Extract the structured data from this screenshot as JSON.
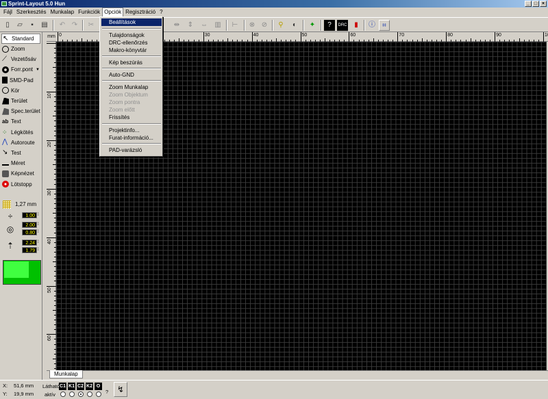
{
  "window": {
    "title": "Sprint-Layout 5.0 Hun"
  },
  "menu": [
    "Fájl",
    "Szerkesztés",
    "Munkalap",
    "Funkciók",
    "Opciók",
    "Regisztráció",
    "?"
  ],
  "dropdown": {
    "items": [
      {
        "label": "Beállítások",
        "state": "highlighted"
      },
      {
        "label": "Tulajdonságok",
        "state": "enabled"
      },
      {
        "label": "DRC-ellenőrzés",
        "state": "enabled"
      },
      {
        "label": "Makro-könyvtár",
        "state": "enabled"
      },
      {
        "label": "Kép beszúrás",
        "state": "enabled"
      },
      {
        "label": "Auto-GND",
        "state": "enabled"
      },
      {
        "label": "Zoom Munkalap",
        "state": "enabled"
      },
      {
        "label": "Zoom Objektum",
        "state": "disabled"
      },
      {
        "label": "Zoom pontra",
        "state": "disabled"
      },
      {
        "label": "Zoom előtt",
        "state": "disabled"
      },
      {
        "label": "Frissítés",
        "state": "enabled"
      },
      {
        "label": "Projektinfo...",
        "state": "enabled"
      },
      {
        "label": "Furat-információ...",
        "state": "enabled"
      },
      {
        "label": "PAD-varázsló",
        "state": "enabled"
      }
    ]
  },
  "tools": [
    {
      "label": "Standard",
      "icon": "arrow-icon"
    },
    {
      "label": "Zoom",
      "icon": "zoom-icon"
    },
    {
      "label": "Vezetősáv",
      "icon": "track-icon"
    },
    {
      "label": "Forr.pont",
      "icon": "solder-pad-icon"
    },
    {
      "label": "SMD-Pad",
      "icon": "smd-pad-icon"
    },
    {
      "label": "Kör",
      "icon": "circle-icon"
    },
    {
      "label": "Terület",
      "icon": "zone-icon"
    },
    {
      "label": "Spec.terület",
      "icon": "special-zone-icon"
    },
    {
      "label": "Text",
      "icon": "text-icon"
    },
    {
      "label": "Légkötés",
      "icon": "airwire-icon"
    },
    {
      "label": "Autoroute",
      "icon": "autoroute-icon"
    },
    {
      "label": "Test",
      "icon": "test-icon"
    },
    {
      "label": "Méret",
      "icon": "measure-icon"
    },
    {
      "label": "Képnézet",
      "icon": "photoview-icon"
    },
    {
      "label": "Lötstopp",
      "icon": "solder-mask-icon"
    }
  ],
  "grid": {
    "value": "1,27 mm"
  },
  "params": {
    "track_width": "1.00",
    "pad_outer": "2.00",
    "pad_inner": "0.80",
    "smd_w": "2.24",
    "smd_h": "1.79"
  },
  "ruler": {
    "unit": "mm",
    "h_labels": [
      "0",
      "10",
      "20",
      "30",
      "40",
      "50",
      "60",
      "70",
      "80",
      "90",
      "100"
    ],
    "v_labels": [
      "0",
      "10",
      "20",
      "30",
      "40",
      "50",
      "60"
    ]
  },
  "tab": {
    "label": "Munkalap"
  },
  "status": {
    "x_label": "X:",
    "x_value": "51,6 mm",
    "y_label": "Y:",
    "y_value": "19,9 mm",
    "visible_label": "Látható",
    "active_label": "aktív",
    "layers": [
      "C1",
      "K1",
      "C2",
      "K2",
      "O"
    ],
    "help": "?"
  },
  "colors": {
    "board": "#000000",
    "grid": "#3a3a3a",
    "copper_color": "#40ff40",
    "highlight": "#0a246a"
  }
}
